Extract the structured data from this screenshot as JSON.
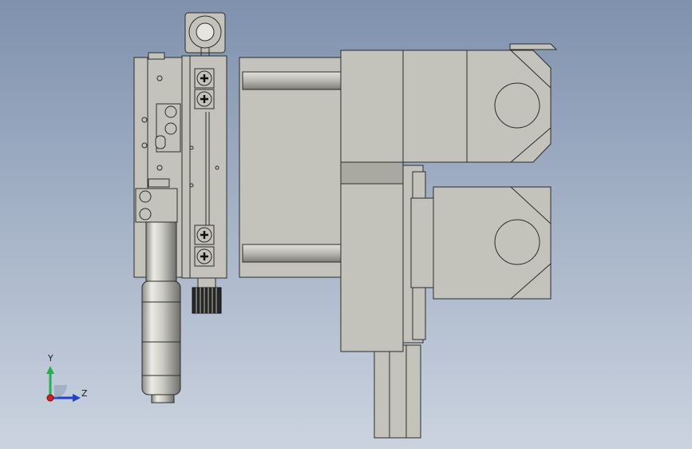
{
  "triad": {
    "y_label": "Y",
    "z_label": "Z",
    "colors": {
      "y_axis": "#22b14c",
      "z_axis": "#2040d0",
      "x_axis": "#d02020"
    }
  },
  "colors": {
    "background_top": "#7f91ad",
    "background_bottom": "#cbd3df",
    "part_fill": "#c3c3bb",
    "edge": "#2c2c2c"
  }
}
